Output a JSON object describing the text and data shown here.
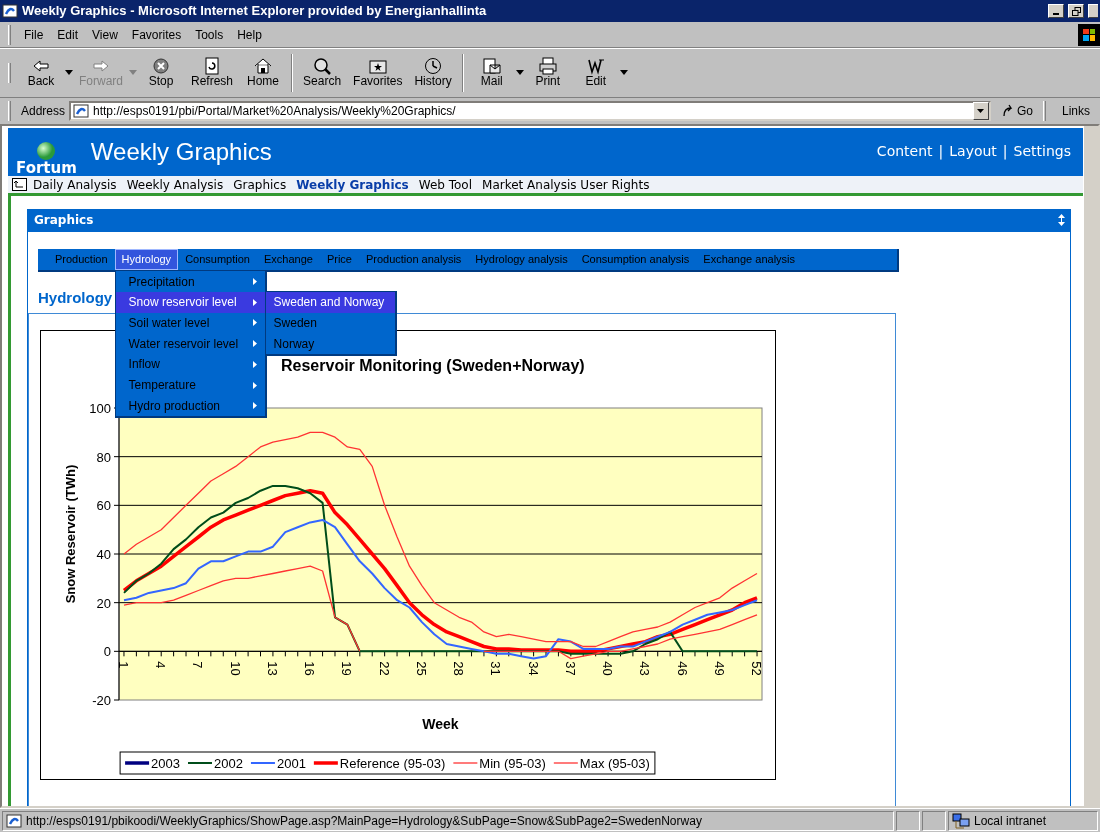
{
  "window": {
    "title": "Weekly Graphics - Microsoft Internet Explorer provided by Energianhallinta"
  },
  "menu_bar": [
    {
      "label": "File"
    },
    {
      "label": "Edit"
    },
    {
      "label": "View"
    },
    {
      "label": "Favorites"
    },
    {
      "label": "Tools"
    },
    {
      "label": "Help"
    }
  ],
  "toolbar": [
    {
      "kind": "back",
      "label": "Back",
      "disabled": false,
      "dropdown": true
    },
    {
      "kind": "forward",
      "label": "Forward",
      "disabled": true,
      "dropdown": true
    },
    {
      "kind": "stop",
      "label": "Stop",
      "disabled": false,
      "dropdown": false
    },
    {
      "kind": "refresh",
      "label": "Refresh",
      "disabled": false,
      "dropdown": false
    },
    {
      "kind": "home",
      "label": "Home",
      "disabled": false,
      "dropdown": false
    },
    {
      "kind": "search",
      "label": "Search",
      "disabled": false,
      "dropdown": false
    },
    {
      "kind": "favorites",
      "label": "Favorites",
      "disabled": false,
      "dropdown": false
    },
    {
      "kind": "history",
      "label": "History",
      "disabled": false,
      "dropdown": false
    },
    {
      "kind": "mail",
      "label": "Mail",
      "disabled": false,
      "dropdown": true
    },
    {
      "kind": "print",
      "label": "Print",
      "disabled": false,
      "dropdown": false
    },
    {
      "kind": "edit",
      "label": "Edit",
      "disabled": false,
      "dropdown": true
    }
  ],
  "address_bar": {
    "label": "Address",
    "url": "http://esps0191/pbi/Portal/Market%20Analysis/Weekly%20Graphics/",
    "go": "Go",
    "links": "Links"
  },
  "site_header": {
    "logo": "Fortum",
    "title": "Weekly Graphics",
    "links": [
      "Content",
      "Layout",
      "Settings"
    ],
    "separator": "|"
  },
  "site_nav": [
    {
      "label": "Daily Analysis",
      "selected": false
    },
    {
      "label": "Weekly Analysis",
      "selected": false
    },
    {
      "label": "Graphics",
      "selected": false
    },
    {
      "label": "Weekly Graphics",
      "selected": true
    },
    {
      "label": "Web Tool",
      "selected": false
    },
    {
      "label": "Market Analysis User Rights",
      "selected": false
    }
  ],
  "panel": {
    "title": "Graphics",
    "category_menu": [
      {
        "label": "Production",
        "selected": false
      },
      {
        "label": "Hydrology",
        "selected": true
      },
      {
        "label": "Consumption",
        "selected": false
      },
      {
        "label": "Exchange",
        "selected": false
      },
      {
        "label": "Price",
        "selected": false
      },
      {
        "label": "Production analysis",
        "selected": false
      },
      {
        "label": "Hydrology analysis",
        "selected": false
      },
      {
        "label": "Consumption analysis",
        "selected": false
      },
      {
        "label": "Exchange analysis",
        "selected": false
      }
    ],
    "dropdown": [
      {
        "label": "Precipitation",
        "selected": false
      },
      {
        "label": "Snow reservoir level",
        "selected": true
      },
      {
        "label": "Soil water level",
        "selected": false
      },
      {
        "label": "Water reservoir level",
        "selected": false
      },
      {
        "label": "Inflow",
        "selected": false
      },
      {
        "label": "Temperature",
        "selected": false
      },
      {
        "label": "Hydro production",
        "selected": false
      }
    ],
    "submenu": [
      {
        "label": "Sweden and Norway",
        "selected": true
      },
      {
        "label": "Sweden",
        "selected": false
      },
      {
        "label": "Norway",
        "selected": false
      }
    ],
    "heading": "Hydrology",
    "chart_data": {
      "type": "line",
      "title": "Reservoir Monitoring (Sweden+Norway)",
      "xlabel": "Week",
      "ylabel": "Snow Reservoir (TWh)",
      "x": [
        1,
        2,
        3,
        4,
        5,
        6,
        7,
        8,
        9,
        10,
        11,
        12,
        13,
        14,
        15,
        16,
        17,
        18,
        19,
        20,
        21,
        22,
        23,
        24,
        25,
        26,
        27,
        28,
        29,
        30,
        31,
        32,
        33,
        34,
        35,
        36,
        37,
        38,
        39,
        40,
        41,
        42,
        43,
        44,
        45,
        46,
        47,
        48,
        49,
        50,
        51,
        52
      ],
      "xlim": [
        0.6,
        52.4
      ],
      "ylim": [
        -20,
        100
      ],
      "xticks": [
        1,
        4,
        7,
        10,
        13,
        16,
        19,
        22,
        25,
        28,
        31,
        34,
        37,
        40,
        43,
        46,
        49,
        52
      ],
      "yticks": [
        -20,
        0,
        20,
        40,
        60,
        80,
        100
      ],
      "grid": true,
      "legend": true,
      "series": [
        {
          "name": "2003",
          "color": "#000080",
          "values": [
            null,
            null,
            null,
            null,
            null,
            null,
            null,
            null,
            null,
            null,
            null,
            null,
            null,
            null,
            null,
            null,
            null,
            null,
            null,
            null,
            null,
            null,
            null,
            null,
            null,
            null,
            null,
            null,
            null,
            null,
            null,
            null,
            null,
            null,
            null,
            null,
            null,
            null,
            null,
            null,
            null,
            null,
            null,
            null,
            null,
            null,
            null,
            null,
            null,
            null,
            null,
            null
          ]
        },
        {
          "name": "2002",
          "color": "#004d1a",
          "values": [
            24,
            29,
            32,
            36,
            42,
            46,
            51,
            55,
            57,
            61,
            63,
            66,
            68,
            68,
            67,
            65,
            61,
            14,
            11,
            0,
            0,
            0,
            0,
            0,
            0,
            0,
            0,
            0,
            0,
            0,
            0,
            0,
            0,
            0,
            0,
            0,
            -1,
            -1,
            -1,
            -1,
            -1,
            0,
            3,
            5,
            8,
            0,
            0,
            0,
            0,
            0,
            0,
            0
          ]
        },
        {
          "name": "2001",
          "color": "#3366ff",
          "values": [
            21,
            22,
            24,
            25,
            26,
            28,
            34,
            37,
            37,
            39,
            41,
            41,
            43,
            49,
            51,
            53,
            54,
            51,
            44,
            37,
            32,
            26,
            21,
            18,
            12,
            7,
            3,
            2,
            1,
            0,
            -1,
            -1,
            -2,
            -3,
            -2,
            5,
            4,
            1,
            1,
            1,
            2,
            2,
            4,
            6,
            8,
            11,
            13,
            15,
            16,
            17,
            19,
            21
          ]
        },
        {
          "name": "Reference (95-03)",
          "color": "#ff0000",
          "values": [
            25,
            29,
            32,
            35,
            39,
            43,
            47,
            51,
            54,
            56,
            58,
            60,
            62,
            64,
            65,
            66,
            65,
            57,
            52,
            46,
            40,
            34,
            27,
            20,
            15,
            11,
            8,
            6,
            4,
            2,
            1,
            1,
            0.5,
            0.5,
            0.5,
            0.5,
            0,
            0,
            0,
            1,
            2,
            3,
            4,
            6,
            7,
            9,
            11,
            13,
            15,
            17,
            20,
            22
          ]
        },
        {
          "name": "Min (95-03)",
          "color": "#ff3333",
          "values": [
            19,
            20,
            20,
            20,
            21,
            23,
            25,
            27,
            29,
            30,
            30,
            31,
            32,
            33,
            34,
            35,
            33,
            14,
            11,
            0,
            null,
            null,
            null,
            null,
            null,
            null,
            null,
            null,
            null,
            0,
            0,
            0,
            0,
            0,
            0,
            0,
            -3,
            -2,
            -1,
            0,
            0,
            1,
            2,
            3,
            5,
            6,
            7,
            8,
            9,
            11,
            13,
            15
          ]
        },
        {
          "name": "Max (95-03)",
          "color": "#ff3333",
          "values": [
            40,
            44,
            47,
            50,
            55,
            60,
            65,
            70,
            73,
            76,
            80,
            84,
            86,
            87,
            88,
            90,
            90,
            88,
            84,
            83,
            76,
            60,
            47,
            35,
            27,
            20,
            17,
            14,
            12,
            8,
            6,
            7,
            6,
            5,
            4,
            4,
            4,
            2,
            2,
            4,
            6,
            8,
            9,
            10,
            12,
            15,
            18,
            20,
            22,
            26,
            29,
            32
          ]
        }
      ]
    }
  },
  "status_bar": {
    "url": "http://esps0191/pbikoodi/WeeklyGraphics/ShowPage.asp?MainPage=Hydrology&SubPage=Snow&SubPage2=SwedenNorway",
    "zone": "Local intranet"
  }
}
